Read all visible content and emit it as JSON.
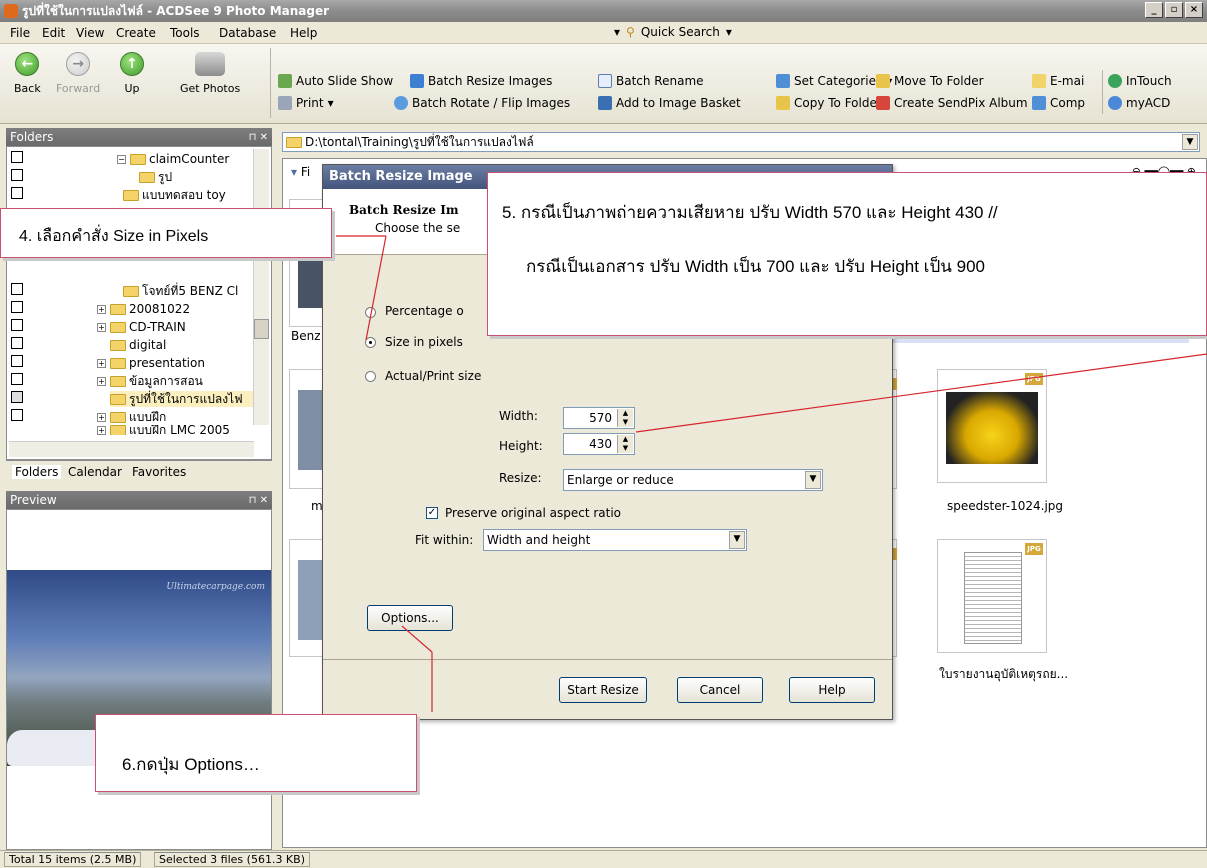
{
  "window": {
    "title": "รูปที่ใช้ในการแปลงไฟล์ - ACDSee 9 Photo Manager",
    "min": "_",
    "max": "▫",
    "close": "×"
  },
  "menu": {
    "items": [
      "File",
      "Edit",
      "View",
      "Create",
      "Tools",
      "Database",
      "Help"
    ],
    "quick_search": "Quick Search"
  },
  "toolbar": {
    "back": "Back",
    "forward": "Forward",
    "up": "Up",
    "get_photos": "Get Photos",
    "auto_slide_show": "Auto Slide Show",
    "print": "Print",
    "batch_resize": "Batch Resize Images",
    "batch_rotate": "Batch Rotate / Flip Images",
    "batch_rename": "Batch Rename",
    "add_basket": "Add to Image Basket",
    "set_categories": "Set Categories",
    "copy_to_folder": "Copy To Folder",
    "move_to_folder": "Move To Folder",
    "create_sendpix": "Create SendPix Album",
    "email": "E-mai",
    "compare": "Comp",
    "intouch": "InTouch",
    "myacd": "myACD"
  },
  "folders": {
    "header": "Folders",
    "items": [
      "claimCounter",
      "รูป",
      "แบบทดสอบ toy",
      "โจทย์ที่5 BENZ Cl",
      "20081022",
      "CD-TRAIN",
      "digital",
      "presentation",
      "ข้อมูลการสอน",
      "รูปที่ใช้ในการแปลงไฟ",
      "แบบฝึก",
      "แบบฝึก LMC 2005"
    ],
    "tabs": [
      "Folders",
      "Calendar",
      "Favorites"
    ]
  },
  "preview": {
    "header": "Preview",
    "watermark": "Ultimatecarpage.com"
  },
  "address": {
    "path": "D:\\tontal\\Training\\รูปที่ใช้ในการแปลงไฟล์"
  },
  "browser": {
    "filter_label": "Fi",
    "captions": [
      "Benz",
      "m",
      "speedster-1024.jpg",
      "....",
      "ใบรายงานอุบัติเหตุรถย..."
    ],
    "jpg_badge": "JPG"
  },
  "dialog": {
    "title": "Batch Resize Image",
    "header_title": "Batch Resize Im",
    "header_sub": "Choose the se",
    "opt_percentage": "Percentage o",
    "opt_pixels": "Size in pixels",
    "opt_actual": "Actual/Print size",
    "width_label": "Width:",
    "width_value": "570",
    "height_label": "Height:",
    "height_value": "430",
    "resize_label": "Resize:",
    "resize_value": "Enlarge or reduce",
    "preserve_label": "Preserve original aspect ratio",
    "fit_label": "Fit within:",
    "fit_value": "Width and height",
    "options_btn": "Options...",
    "start_btn": "Start Resize",
    "cancel_btn": "Cancel",
    "help_btn": "Help"
  },
  "callouts": {
    "c4": "4. เลือกคำสั่ง Size in Pixels",
    "c5_line1": "5. กรณีเป็นภาพถ่ายความเสียหาย ปรับ Width 570 และ  Height  430 //",
    "c5_line2": "กรณีเป็นเอกสาร ปรับ Width เป็น 700 และ ปรับ Height เป็น 900",
    "c6": "6.กดปุ่ม Options…"
  },
  "status": {
    "total": "Total 15 items  (2.5 MB)",
    "selected": "Selected 3 files (561.3 KB)"
  },
  "colors": {
    "callout_border": "#c9506f",
    "annot_line": "#d6262e",
    "title_bg": "#44557d"
  }
}
